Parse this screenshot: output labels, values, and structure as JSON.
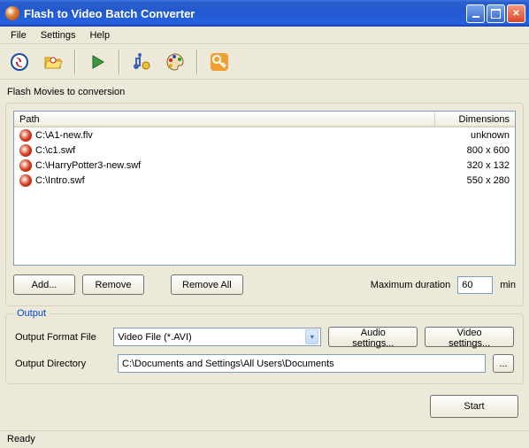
{
  "window": {
    "title": "Flash to Video Batch Converter"
  },
  "menu": {
    "file": "File",
    "settings": "Settings",
    "help": "Help"
  },
  "section_label": "Flash Movies to conversion",
  "columns": {
    "path": "Path",
    "dimensions": "Dimensions"
  },
  "files": [
    {
      "path": "C:\\A1-new.flv",
      "dim": "unknown"
    },
    {
      "path": "C:\\c1.swf",
      "dim": "800 x 600"
    },
    {
      "path": "C:\\HarryPotter3-new.swf",
      "dim": "320 x 132"
    },
    {
      "path": "C:\\Intro.swf",
      "dim": "550 x 280"
    }
  ],
  "buttons": {
    "add": "Add...",
    "remove": "Remove",
    "remove_all": "Remove All",
    "audio": "Audio settings...",
    "video": "Video settings...",
    "browse": "...",
    "start": "Start"
  },
  "max_duration": {
    "label": "Maximum duration",
    "value": "60",
    "unit": "min"
  },
  "output": {
    "legend": "Output",
    "format_label": "Output Format File",
    "format_value": "Video File (*.AVI)",
    "dir_label": "Output Directory",
    "dir_value": "C:\\Documents and Settings\\All Users\\Documents"
  },
  "status": "Ready"
}
